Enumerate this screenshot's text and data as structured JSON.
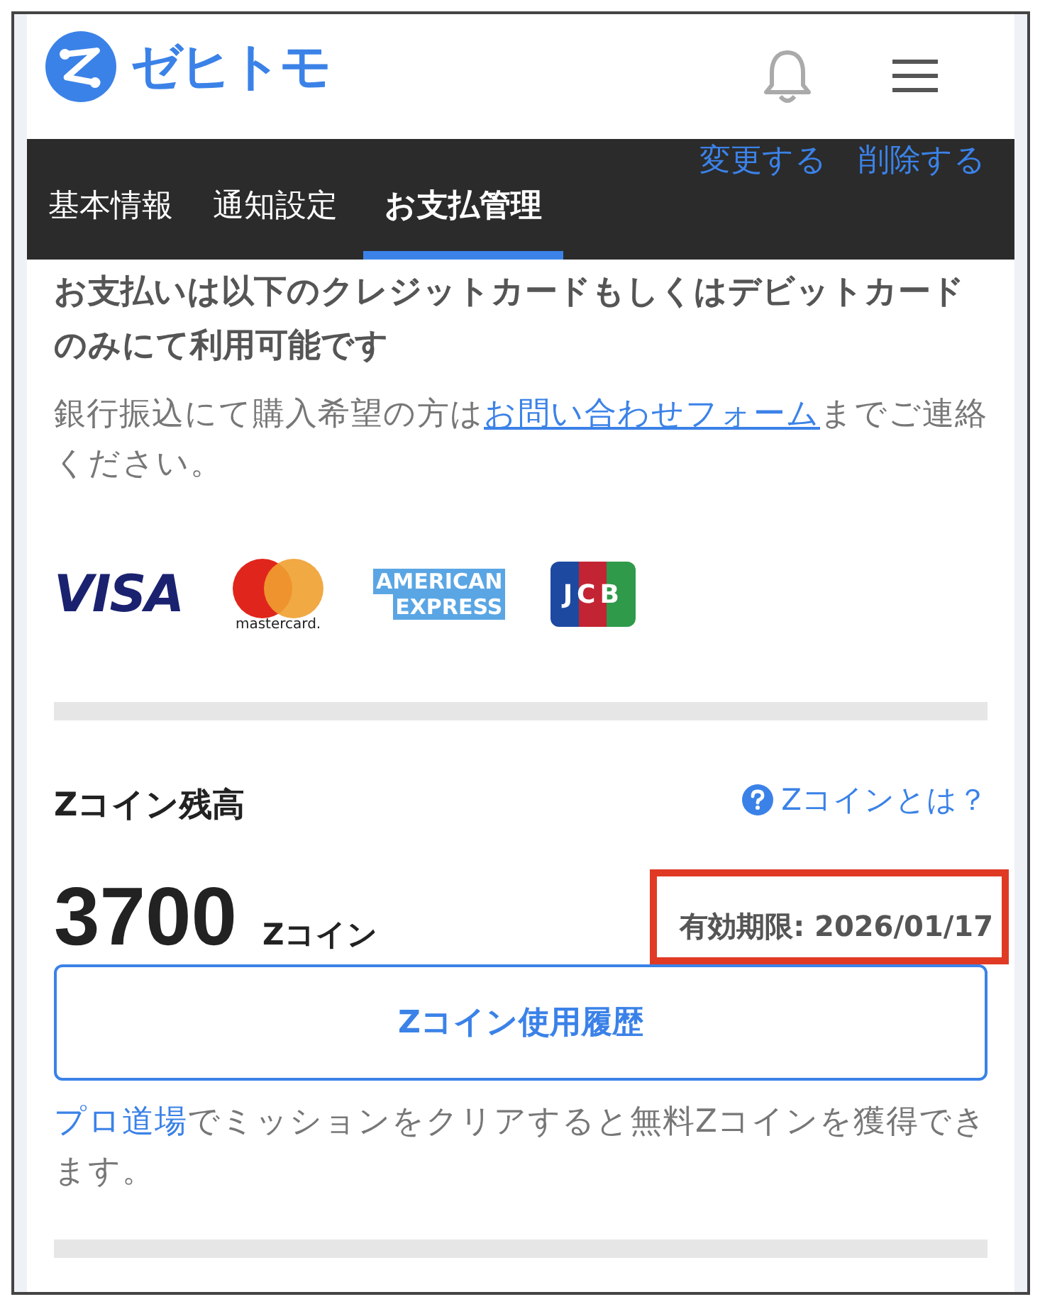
{
  "header": {
    "logo_text": "ゼヒトモ"
  },
  "tabs": [
    {
      "label": "基本情報",
      "selected": false
    },
    {
      "label": "通知設定",
      "selected": false
    },
    {
      "label": "お支払管理",
      "selected": true
    }
  ],
  "overlay_links": [
    "変更する",
    "削除する"
  ],
  "payment": {
    "notice": "お支払いは以下のクレジットカードもしくはデビットカードのみにて利用可能です",
    "bank_before": "銀行振込にて購入希望の方は",
    "bank_link": "お問い合わせフォーム",
    "bank_after": "までご連絡ください。",
    "cards": [
      {
        "kind": "visa",
        "text": "VISA"
      },
      {
        "kind": "mastercard",
        "text": "mastercard."
      },
      {
        "kind": "amex",
        "text": "AMERICAN",
        "text2": "EXPRESS"
      },
      {
        "kind": "jcb",
        "text": "JCB"
      }
    ]
  },
  "coins": {
    "title": "Zコイン残高",
    "help_link": "Zコインとは？",
    "amount": "3700",
    "unit": "Zコイン",
    "expiry": "有効期限: 2026/01/17",
    "expiry_highlighted": true,
    "history_button": "Zコイン使用履歴",
    "note_link": "プロ道場",
    "note_text": "でミッションをクリアすると無料Zコインを獲得できます。"
  }
}
